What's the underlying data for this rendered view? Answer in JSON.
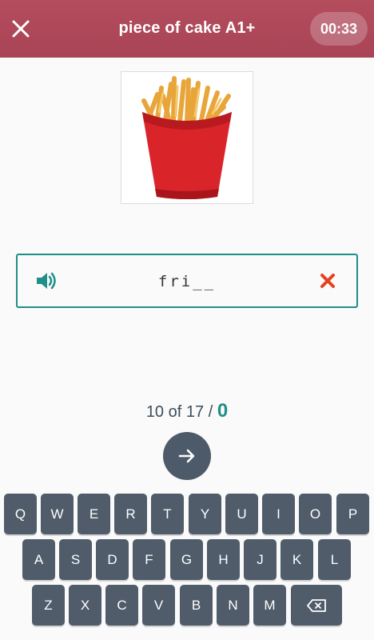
{
  "header": {
    "title": "piece of cake A1+",
    "timer": "00:33",
    "close_icon": "close-icon",
    "background": "#a84456"
  },
  "image": {
    "subject": "french-fries-icon"
  },
  "answer": {
    "text": "fri__",
    "speaker_icon": "speaker-icon",
    "clear_icon": "clear-x-icon",
    "accent": "#1f8f88",
    "clear_color": "#e5411e"
  },
  "progress": {
    "current": "10",
    "of_label": "of",
    "total": "17",
    "separator": "/",
    "score": "0"
  },
  "next_button": {
    "icon": "arrow-right-icon"
  },
  "keyboard": {
    "row1": [
      "Q",
      "W",
      "E",
      "R",
      "T",
      "Y",
      "U",
      "I",
      "O",
      "P"
    ],
    "row2": [
      "A",
      "S",
      "D",
      "F",
      "G",
      "H",
      "J",
      "K",
      "L"
    ],
    "row3": [
      "Z",
      "X",
      "C",
      "V",
      "B",
      "N",
      "M"
    ],
    "backspace_icon": "backspace-icon"
  }
}
